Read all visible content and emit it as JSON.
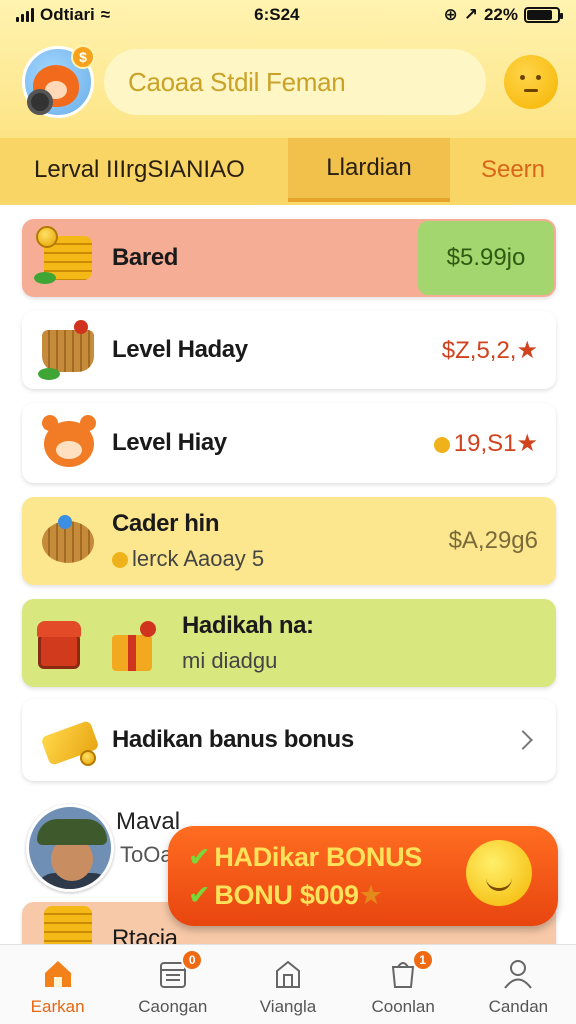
{
  "status_bar": {
    "carrier": "Odtiari",
    "time": "6:S24",
    "battery": "22%"
  },
  "header": {
    "search_placeholder": "Caoaa Stdil Feman",
    "coin_badge": "$"
  },
  "tabs": [
    {
      "label": "Lerval IIIrgSIANIAO"
    },
    {
      "label": "Llardian"
    },
    {
      "label": "Seern"
    }
  ],
  "list": [
    {
      "title": "Bared",
      "value": "$5.99jo",
      "icon": "coin-stack-icon"
    },
    {
      "title": "Level Haday",
      "value": "$Z,5,2,★",
      "icon": "basket-icon"
    },
    {
      "title": "Level Hiay",
      "value": "19,S1★",
      "icon": "bear-icon"
    },
    {
      "title": "Cader hin",
      "subtitle": "lerck Aaoay 5",
      "value": "$A,29g6",
      "icon": "basket-icon"
    },
    {
      "title": "Hadikah na:",
      "subtitle": "mi diadgu",
      "icon": "gift-chest-icon"
    },
    {
      "title": "Hadikan banus bonus",
      "icon": "ticket-icon"
    }
  ],
  "person": {
    "name": "Maval",
    "subtitle": "ToOa"
  },
  "last_row": {
    "title": "Rtacia"
  },
  "bonus_banner": {
    "line1": "HADikar BONUS",
    "line2": "BONU $009"
  },
  "bottom_nav": [
    {
      "label": "Earkan",
      "icon": "home-icon",
      "active": true
    },
    {
      "label": "Caongan",
      "icon": "calendar-icon",
      "badge": "0"
    },
    {
      "label": "Viangla",
      "icon": "shop-icon"
    },
    {
      "label": "Coonlan",
      "icon": "bag-icon",
      "badge": "1"
    },
    {
      "label": "Candan",
      "icon": "person-icon"
    }
  ],
  "colors": {
    "accent": "#f06a14",
    "header_bg": "#fde68a",
    "positive": "#a3d66e"
  }
}
